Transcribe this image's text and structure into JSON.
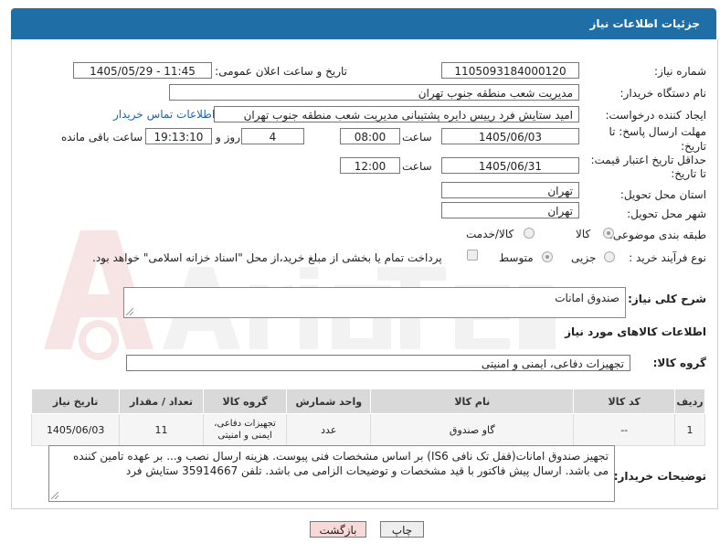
{
  "header": {
    "title": "جزئیات اطلاعات نیاز"
  },
  "form": {
    "need_number_label": "شماره نیاز:",
    "need_number": "1105093184000120",
    "announce_label": "تاریخ و ساعت اعلان عمومی:",
    "announce_value": "1405/05/29 - 11:45",
    "buyer_org_label": "نام دستگاه خریدار:",
    "buyer_org": "مدیریت شعب منطقه جنوب تهران",
    "creator_label": "ایجاد کننده درخواست:",
    "creator": "امید ستایش فرد رییس دایره پشتیبانی مدیریت شعب منطقه جنوب تهران",
    "buyer_contact_link": "اطلاعات تماس خریدار",
    "deadline_label_1": "مهلت ارسال پاسخ: تا",
    "deadline_label_2": "تاریخ:",
    "deadline_date": "1405/06/03",
    "time_word": "ساعت",
    "deadline_time": "08:00",
    "days_value": "4",
    "days_word": "روز و",
    "remaining_time": "19:13:10",
    "remaining_word": "ساعت باقی مانده",
    "min_price_label_1": "حداقل تاریخ اعتبار قیمت:",
    "min_price_label_2": "تا تاریخ:",
    "min_price_date": "1405/06/31",
    "min_price_time": "12:00",
    "province_label": "استان محل تحویل:",
    "province": "تهران",
    "city_label": "شهر محل تحویل:",
    "city": "تهران",
    "category_label": "طبقه بندی موضوعی:",
    "category_goods": "کالا",
    "category_goods_services": "کالا/خدمت",
    "process_label": "نوع فرآیند خرید :",
    "process_partial": "جزیی",
    "process_medium": "متوسط",
    "payment_note": "پرداخت تمام یا بخشی از مبلغ خرید،از محل \"اسناد خزانه اسلامی\" خواهد بود."
  },
  "general_desc": {
    "label": "شرح کلی نیاز:",
    "value": "صندوق امانات"
  },
  "goods_section": {
    "title": "اطلاعات کالاهای مورد نیاز",
    "group_label": "گروه کالا:",
    "group_value": "تجهیزات دفاعی، ایمنی و امنیتی"
  },
  "table": {
    "headers": [
      "ردیف",
      "کد کالا",
      "نام کالا",
      "واحد شمارش",
      "گروه کالا",
      "تعداد / مقدار",
      "تاریخ نیاز"
    ],
    "rows": [
      [
        "1",
        "--",
        "گاو صندوق",
        "عدد",
        "تجهیزات دفاعی، ایمنی و امنیتی",
        "11",
        "1405/06/03"
      ]
    ]
  },
  "buyer_notes": {
    "label": "توضیحات خریدار:",
    "value": "تجهیز صندوق امانات(قفل تک نافی IS6) بر اساس مشخصات فنی پیوست. هزینه ارسال نصب و... بر عهده تامین کننده می باشد. ارسال پیش فاکتور با قید مشخصات و توضیحات الزامی می باشد. تلفن 35914667 ستایش فرد"
  },
  "buttons": {
    "print": "چاپ",
    "back": "بازگشت"
  },
  "watermark": {
    "text": "AriaTender.neT"
  },
  "colors": {
    "header": "#1f6fa6",
    "link": "#1f5fb2",
    "back_button": "#f7d9d9",
    "print_button": "#eeeeee"
  }
}
